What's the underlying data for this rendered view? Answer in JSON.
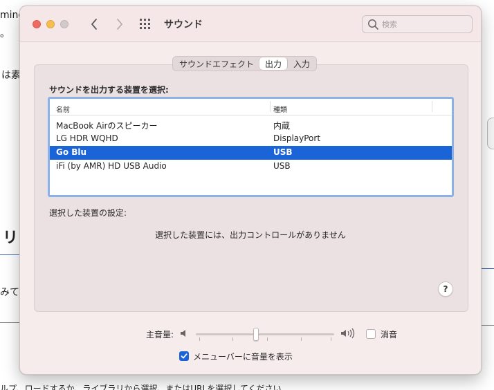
{
  "background": {
    "fragments": [
      "ming",
      "。",
      "は素",
      "リ",
      "みて",
      "ルプ、ロードするか、ライブラリから選択、またはURLを選択してください"
    ]
  },
  "window": {
    "title": "サウンド",
    "search_placeholder": "検索"
  },
  "tabs": [
    {
      "label": "サウンドエフェクト",
      "active": false
    },
    {
      "label": "出力",
      "active": true
    },
    {
      "label": "入力",
      "active": false
    }
  ],
  "output": {
    "section_label": "サウンドを出力する装置を選択:",
    "columns": {
      "name": "名前",
      "type": "種類"
    },
    "devices": [
      {
        "name": "MacBook Airのスピーカー",
        "type": "内蔵",
        "selected": false
      },
      {
        "name": "LG HDR WQHD",
        "type": "DisplayPort",
        "selected": false
      },
      {
        "name": "Go Blu",
        "type": "USB",
        "selected": true
      },
      {
        "name": "iFi (by AMR) HD USB Audio",
        "type": "USB",
        "selected": false
      }
    ],
    "settings_label": "選択した装置の設定:",
    "no_controls_message": "選択した装置には、出力コントロールがありません",
    "help_label": "?"
  },
  "volume": {
    "label": "主音量:",
    "level": 0.43,
    "mute_label": "消音",
    "mute_checked": false,
    "menubar_label": "メニューバーに音量を表示",
    "menubar_checked": true
  },
  "colors": {
    "selection": "#1a64d8",
    "table_focus": "#8bb1e6",
    "window_bg": "#f7ecec"
  }
}
